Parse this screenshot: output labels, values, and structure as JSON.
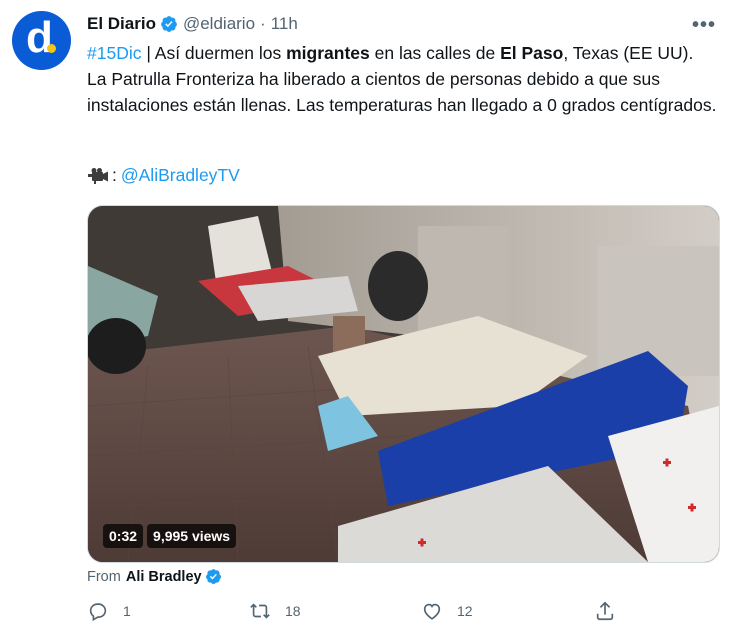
{
  "tweet": {
    "author_name": "El Diario",
    "handle": "@eldiario",
    "separator": "·",
    "time": "11h",
    "more": "•••",
    "hashtag": "#15Dic",
    "text_a": " | Así duermen los ",
    "bold_1": "migrantes",
    "text_b": " en las calles de ",
    "bold_2": "El Paso",
    "text_c": ", Texas (EE UU). La Patrulla Fronteriza ha liberado a cientos de personas debido a que sus instalaciones están llenas. Las temperaturas han llegado a 0 grados centígrados.",
    "credit_colon": ": ",
    "credit_mention": "@AliBradleyTV",
    "video_duration": "0:32",
    "video_views": "9,995 views",
    "from_label": "From",
    "from_name": "Ali Bradley",
    "replies": "1",
    "retweets": "18",
    "likes": "12"
  },
  "colors": {
    "accent": "#1d9bf0",
    "secondary_text": "#536471",
    "avatar_bg": "#0a5bd6"
  },
  "icons": [
    "verified-badge-icon",
    "more-options-icon",
    "video-camera-icon",
    "reply-icon",
    "retweet-icon",
    "like-icon",
    "share-icon"
  ]
}
